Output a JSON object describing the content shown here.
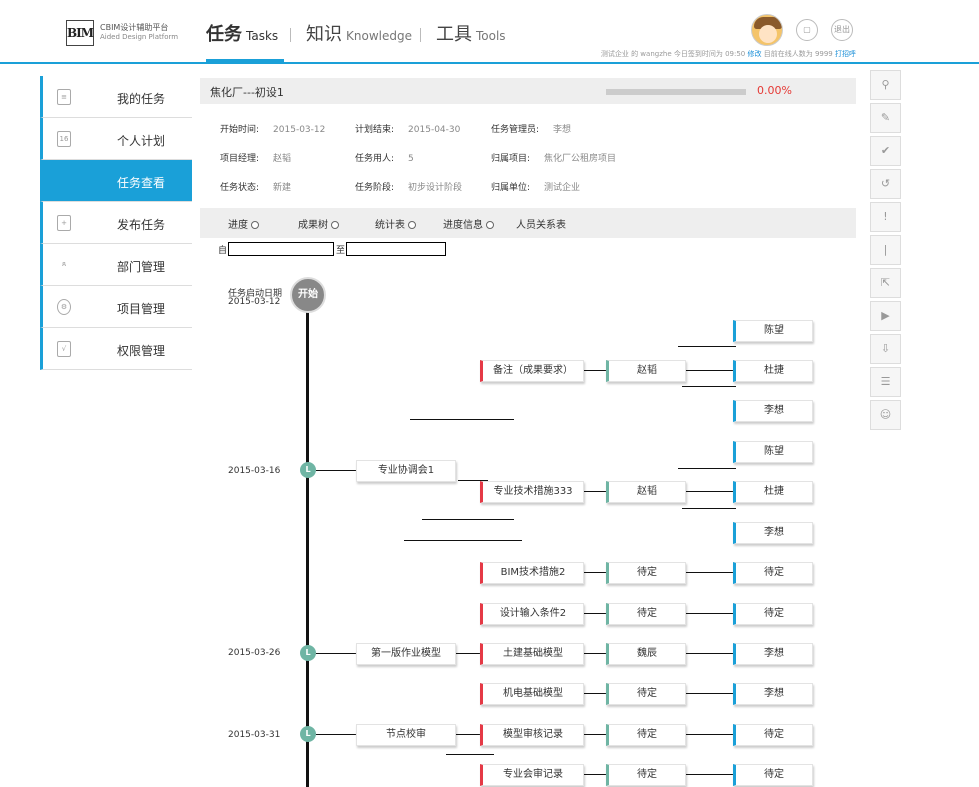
{
  "header": {
    "logo_mark": "BIM",
    "logo_cn": "CBIM设计辅助平台",
    "logo_en": "Aided Design Platform",
    "nav": [
      {
        "cn": "任务",
        "en": "Tasks"
      },
      {
        "cn": "知识",
        "en": "Knowledge"
      },
      {
        "cn": "工具",
        "en": "Tools"
      }
    ],
    "exit_label": "退出",
    "user_line1": "测试企业 的 wangzhe 今日签到时间为 09:50",
    "user_edit": "修改",
    "user_line2": "目前在线人数为 9999",
    "user_greet": "打招呼"
  },
  "sidebar": {
    "items": [
      {
        "label": "我的任务"
      },
      {
        "label": "个人计划",
        "icon_text": "16"
      },
      {
        "label": "任务查看"
      },
      {
        "label": "发布任务"
      },
      {
        "label": "部门管理"
      },
      {
        "label": "项目管理"
      },
      {
        "label": "权限管理"
      }
    ]
  },
  "task": {
    "name": "焦化厂---初设1",
    "progress_fraction": 0.0,
    "progress_text": "0.00%",
    "info": [
      [
        {
          "k": "开始时间:",
          "v": "2015-03-12"
        },
        {
          "k": "计划结束:",
          "v": "2015-04-30"
        },
        {
          "k": "任务管理员:",
          "v": "李想"
        }
      ],
      [
        {
          "k": "项目经理:",
          "v": "赵韬"
        },
        {
          "k": "任务用人:",
          "v": "5"
        },
        {
          "k": "归属项目:",
          "v": "焦化厂公租房项目"
        }
      ],
      [
        {
          "k": "任务状态:",
          "v": "新建"
        },
        {
          "k": "任务阶段:",
          "v": "初步设计阶段"
        },
        {
          "k": "归属单位:",
          "v": "测试企业"
        }
      ]
    ]
  },
  "tabs": [
    "进度",
    "成果树",
    "统计表",
    "进度信息",
    "人员关系表"
  ],
  "date_filter": {
    "from_label": "自",
    "to_label": "至"
  },
  "timeline": {
    "start_label": "开始",
    "start_caption": "任务启动日期",
    "start_date": "2015-03-12",
    "node_letter": "L",
    "milestones": [
      {
        "date": "2015-03-16",
        "name": "专业协调会1"
      },
      {
        "date": "2015-03-26",
        "name": "第一版作业模型"
      },
      {
        "date": "2015-03-31",
        "name": "节点校审"
      }
    ],
    "items": [
      {
        "name": "备注（成果要求）",
        "mid": "赵韬",
        "right": [
          "陈望",
          "杜捷",
          "李想"
        ]
      },
      {
        "name": "专业技术措施333",
        "mid": "赵韬",
        "right": [
          "陈望",
          "杜捷",
          "李想"
        ]
      },
      {
        "name": "BIM技术措施2",
        "mid": "待定",
        "right": [
          "待定"
        ]
      },
      {
        "name": "设计输入条件2",
        "mid": "待定",
        "right": [
          "待定"
        ]
      },
      {
        "name": "土建基础模型",
        "mid": "魏辰",
        "right": [
          "李想"
        ]
      },
      {
        "name": "机电基础模型",
        "mid": "待定",
        "right": [
          "李想"
        ]
      },
      {
        "name": "模型审核记录",
        "mid": "待定",
        "right": [
          "待定"
        ]
      },
      {
        "name": "专业会审记录",
        "mid": "待定",
        "right": [
          "待定"
        ]
      }
    ]
  }
}
